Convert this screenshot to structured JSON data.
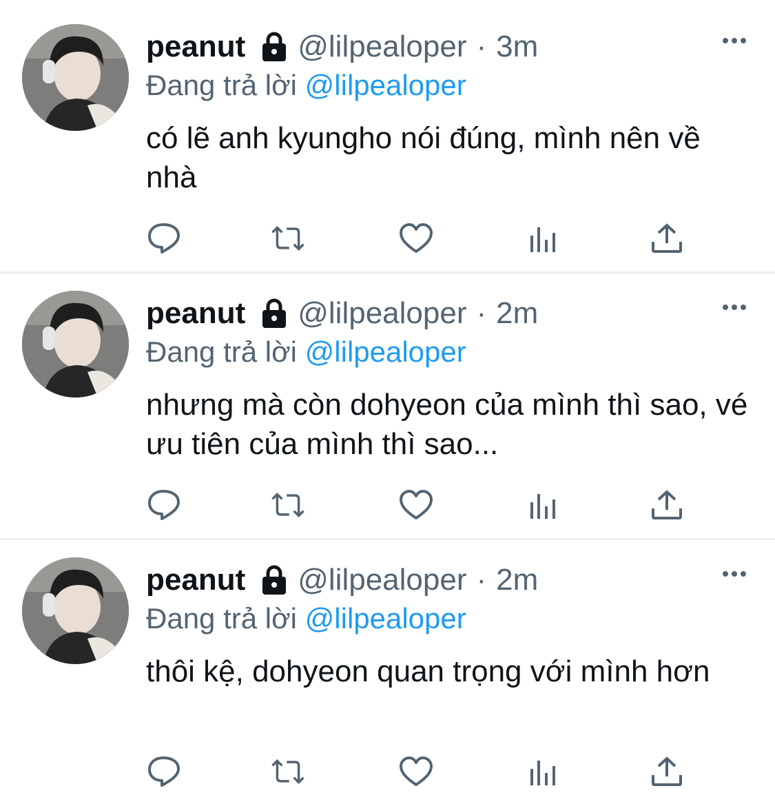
{
  "colors": {
    "text_primary": "#0f1419",
    "text_secondary": "#536471",
    "link": "#1d9bf0",
    "divider": "#eef0f2"
  },
  "tweets": [
    {
      "name": "peanut",
      "handle": "@lilpealoper",
      "separator": "·",
      "time": "3m",
      "reply_prefix": "Đang trả lời",
      "reply_to": "@lilpealoper",
      "text": "có lẽ anh kyungho nói đúng, mình nên về nhà",
      "icons": [
        "lock-icon",
        "more-icon",
        "reply-icon",
        "retweet-icon",
        "like-icon",
        "analytics-icon",
        "share-icon"
      ]
    },
    {
      "name": "peanut",
      "handle": "@lilpealoper",
      "separator": "·",
      "time": "2m",
      "reply_prefix": "Đang trả lời",
      "reply_to": "@lilpealoper",
      "text": "nhưng mà còn dohyeon của mình thì sao, vé ưu tiên của mình thì sao...",
      "icons": [
        "lock-icon",
        "more-icon",
        "reply-icon",
        "retweet-icon",
        "like-icon",
        "analytics-icon",
        "share-icon"
      ]
    },
    {
      "name": "peanut",
      "handle": "@lilpealoper",
      "separator": "·",
      "time": "2m",
      "reply_prefix": "Đang trả lời",
      "reply_to": "@lilpealoper",
      "text": "thôi kệ, dohyeon quan trọng với mình hơn",
      "icons": [
        "lock-icon",
        "more-icon",
        "reply-icon",
        "retweet-icon",
        "like-icon",
        "analytics-icon",
        "share-icon"
      ]
    }
  ]
}
